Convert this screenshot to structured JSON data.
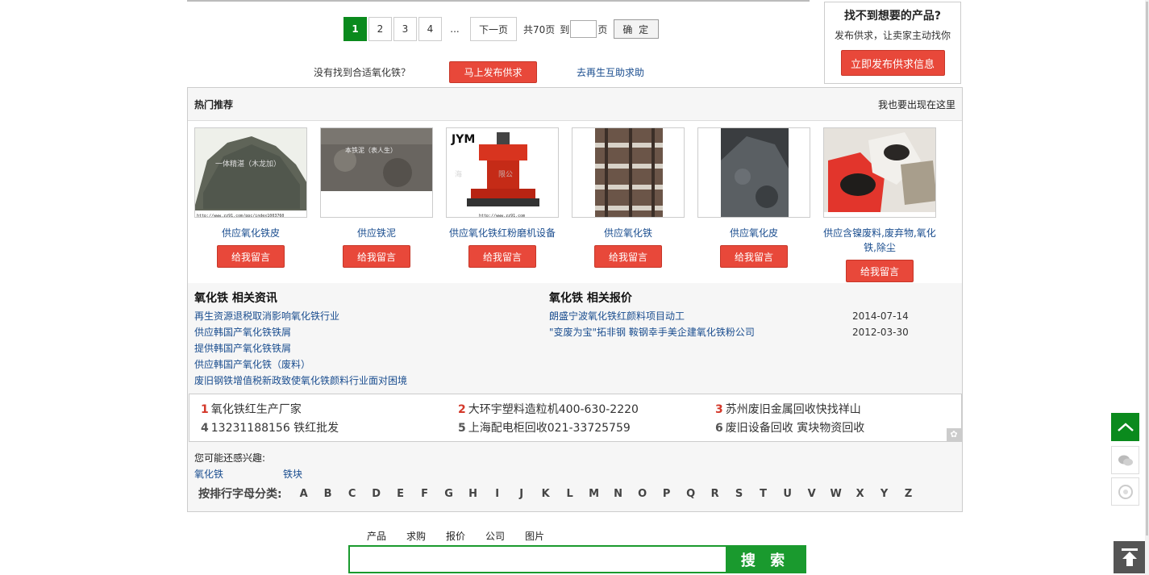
{
  "pagination": {
    "pages": [
      "1",
      "2",
      "3",
      "4"
    ],
    "ellipsis": "...",
    "next_label": "下一页",
    "total": "共70页",
    "goto_label": "到",
    "page_suffix": "页",
    "confirm_label": "确 定",
    "active_color": "#0a8a1d"
  },
  "notfound": {
    "text": "没有找到合适氧化铁？",
    "publish_label": "马上发布供求",
    "help_link": "去再生互助求助"
  },
  "find_box": {
    "title": "找不到想要的产品?",
    "subtitle": "发布供求，让卖家主动找你",
    "button": "立即发布供求信息"
  },
  "hot": {
    "title": "热门推荐",
    "link": "我也要出现在这里",
    "message_label": "给我留言",
    "products": [
      {
        "name": "供应氧化铁皮",
        "image": "photo-pile-dark"
      },
      {
        "name": "供应铁泥",
        "image": "photo-sludge"
      },
      {
        "name": "供应氧化铁红粉磨机设备",
        "image": "photo-machine"
      },
      {
        "name": "供应氧化铁",
        "image": "photo-racks"
      },
      {
        "name": "供应氧化皮",
        "image": "photo-scale"
      },
      {
        "name": "供应含镍废料,废弃物,氧化铁,除尘",
        "image": "photo-bags"
      }
    ]
  },
  "news": {
    "title": "氧化铁 相关资讯",
    "items": [
      "再生资源退税取消影响氧化铁行业",
      "供应韩国产氧化铁铁屑",
      "提供韩国产氧化铁铁屑",
      "供应韩国产氧化铁（废料）",
      "废旧钢铁增值税新政致使氧化铁颜料行业面对困境"
    ]
  },
  "prices": {
    "title": "氧化铁 相关报价",
    "items": [
      {
        "text": "朗盛宁波氧化铁红颜料项目动工",
        "date": "2014-07-14"
      },
      {
        "text": "\"变废为宝\"拓非钢 鞍钢幸手美企建氧化铁粉公司",
        "date": "2012-03-30"
      }
    ]
  },
  "rank": [
    {
      "n": "1",
      "text": "氧化铁红生产厂家"
    },
    {
      "n": "2",
      "text": "大环宇塑料造粒机400-630-2220"
    },
    {
      "n": "3",
      "text": "苏州废旧金属回收快找祥山"
    },
    {
      "n": "4",
      "text": "13231188156 铁红批发"
    },
    {
      "n": "5",
      "text": "上海配电柜回收021-33725759"
    },
    {
      "n": "6",
      "text": "废旧设备回收 寅块物资回收"
    }
  ],
  "interest": {
    "label": "您可能还感兴趣:",
    "keywords": [
      "氧化铁",
      "铁块"
    ]
  },
  "letters": {
    "label": "按排行字母分类:",
    "items": [
      "A",
      "B",
      "C",
      "D",
      "E",
      "F",
      "G",
      "H",
      "I",
      "J",
      "K",
      "L",
      "M",
      "N",
      "O",
      "P",
      "Q",
      "R",
      "S",
      "T",
      "U",
      "V",
      "W",
      "X",
      "Y",
      "Z"
    ]
  },
  "search": {
    "tabs": [
      "产品",
      "求购",
      "报价",
      "公司",
      "图片"
    ],
    "button": "搜 索",
    "placeholder": ""
  }
}
